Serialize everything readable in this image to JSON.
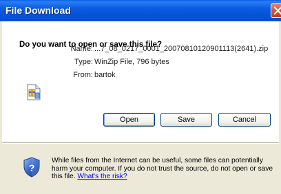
{
  "window": {
    "title": "File Download",
    "question": "Do you want to open or save this file?"
  },
  "file": {
    "name_label": "Name:",
    "name_value": "...7_08_0217_0001_20070810120901113(2641).zip",
    "type_label": "Type:",
    "type_value": "WinZip File, 796 bytes",
    "from_label": "From:",
    "from_value": "bartok"
  },
  "buttons": {
    "open": "Open",
    "save": "Save",
    "cancel": "Cancel"
  },
  "warning": {
    "text": "While files from the Internet can be useful, some files can potentially harm your computer. If you do not trust the source, do not open or save this file.",
    "link": "What's the risk?"
  },
  "icons": {
    "close": "close-icon",
    "file": "zip-file-icon",
    "shield": "security-shield-icon"
  },
  "colors": {
    "titlebar": "#0a5ce0",
    "link": "#0000ff",
    "close_button": "#d65536"
  }
}
